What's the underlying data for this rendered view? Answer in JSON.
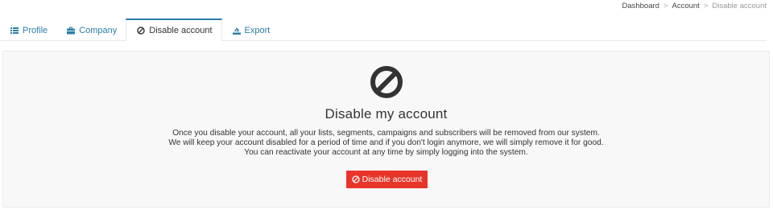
{
  "breadcrumb": {
    "items": [
      "Dashboard",
      "Account",
      "Disable account"
    ],
    "separator": ">"
  },
  "tabs": [
    {
      "label": "Profile",
      "icon": "list-icon"
    },
    {
      "label": "Company",
      "icon": "briefcase-icon"
    },
    {
      "label": "Disable account",
      "icon": "ban-icon",
      "active": true
    },
    {
      "label": "Export",
      "icon": "export-icon"
    }
  ],
  "panel": {
    "icon": "ban-icon",
    "title": "Disable my account",
    "description": [
      "Once you disable your account, all your lists, segments, campaigns and subscribers will be removed from our system.",
      "We will keep your account disabled for a period of time and if you don't login anymore, we will simply remove it for good.",
      "You can reactivate your account at any time by simply logging into the system."
    ],
    "button_label": "Disable account"
  },
  "colors": {
    "accent": "#2a7fa6",
    "danger": "#e8352a",
    "panel_bg": "#f8f8f8"
  }
}
